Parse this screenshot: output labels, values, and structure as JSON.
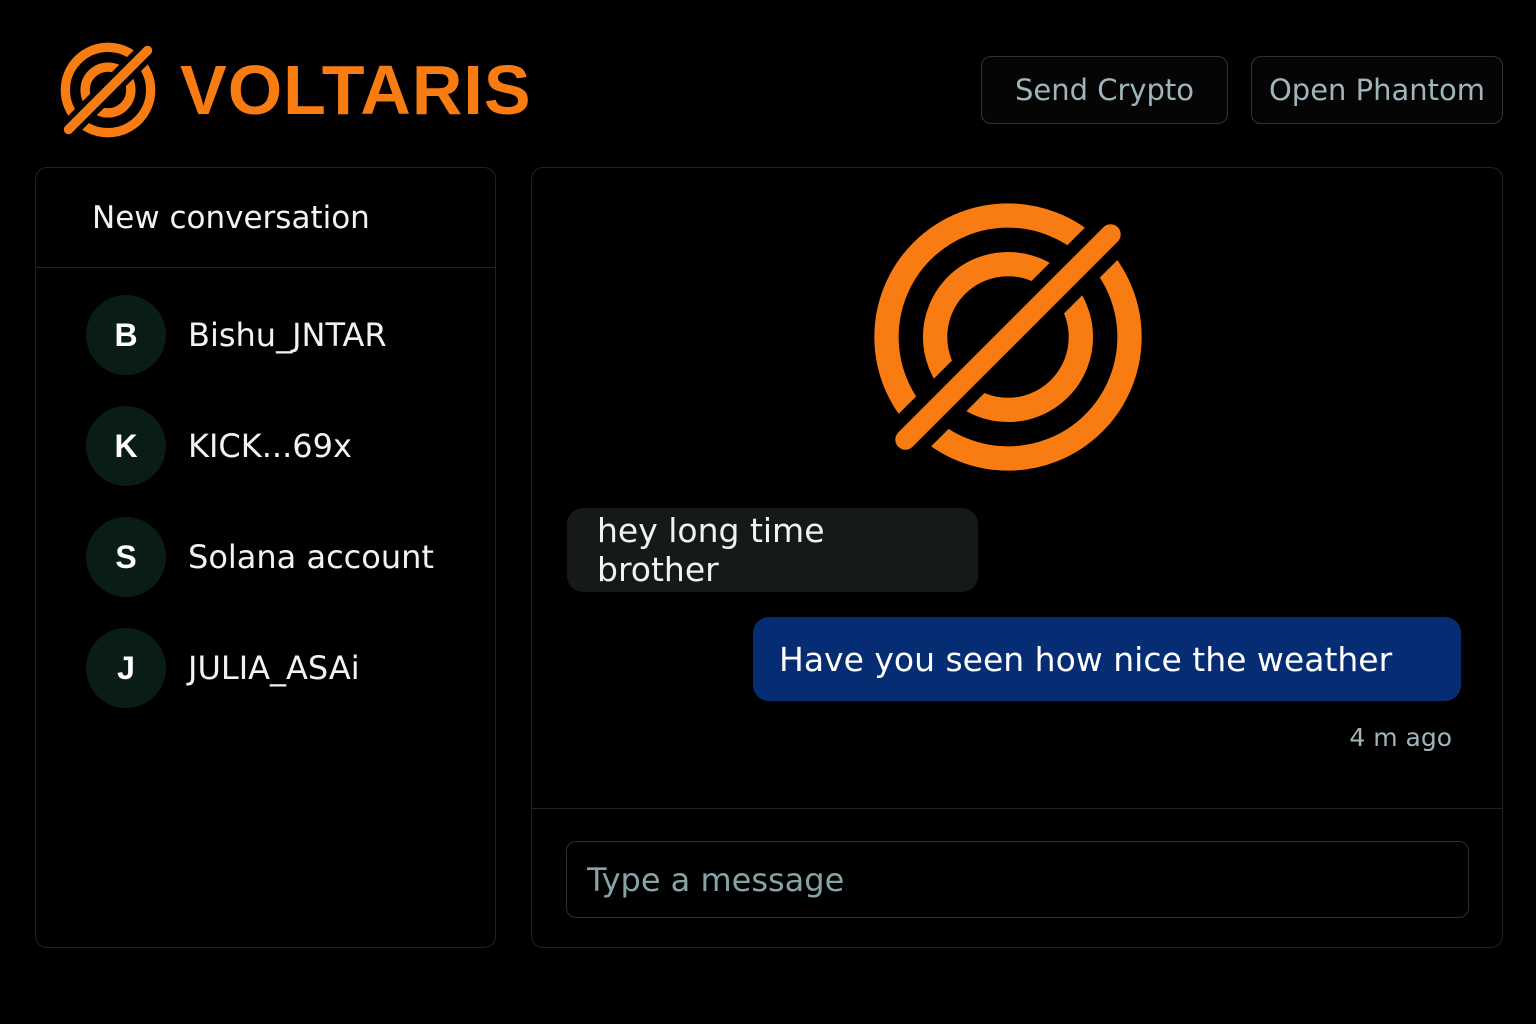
{
  "brand": {
    "name": "VOLTARIS",
    "logo_icon": "voltaris-logo-icon",
    "accent_color": "#f97c12"
  },
  "header": {
    "send_crypto_label": "Send Crypto",
    "open_phantom_label": "Open Phantom"
  },
  "sidebar": {
    "new_conversation_label": "New conversation",
    "conversations": [
      {
        "initial": "B",
        "name": "Bishu_JNTAR"
      },
      {
        "initial": "K",
        "name": "KICK...69x"
      },
      {
        "initial": "S",
        "name": "Solana account"
      },
      {
        "initial": "J",
        "name": "JULIA_ASAi"
      }
    ]
  },
  "chat": {
    "messages": [
      {
        "direction": "incoming",
        "text": "hey long time brother"
      },
      {
        "direction": "outgoing",
        "text": "Have you seen how nice the weather"
      }
    ],
    "last_timestamp": "4 m ago",
    "composer_placeholder": "Type a message",
    "outgoing_color": "#062d73",
    "incoming_color": "#15191a"
  }
}
